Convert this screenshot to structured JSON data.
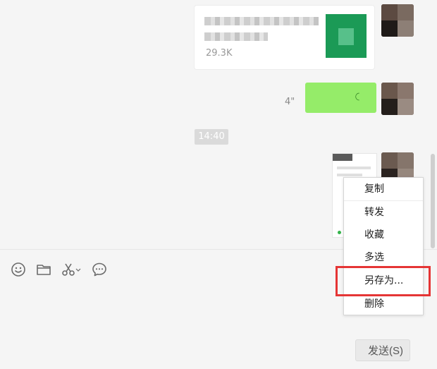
{
  "chat": {
    "file_message": {
      "file_size": "29.3K"
    },
    "voice_message": {
      "duration": "4\"",
      "wave_icon": "voice-wave-icon"
    },
    "timestamp": "14:40"
  },
  "toolbar": {
    "icons": [
      "emoji-icon",
      "folder-icon",
      "scissors-icon",
      "chat-history-icon"
    ]
  },
  "context_menu": {
    "items": [
      {
        "label": "复制"
      },
      {
        "label": "转发"
      },
      {
        "label": "收藏"
      },
      {
        "label": "多选"
      },
      {
        "label": "另存为..."
      },
      {
        "label": "删除"
      }
    ],
    "highlighted_item": "另存为..."
  },
  "composer": {
    "send_label": "发送(S)"
  },
  "colors": {
    "voice_bubble": "#95ec69",
    "highlight": "#e53535",
    "background": "#f5f5f5"
  }
}
